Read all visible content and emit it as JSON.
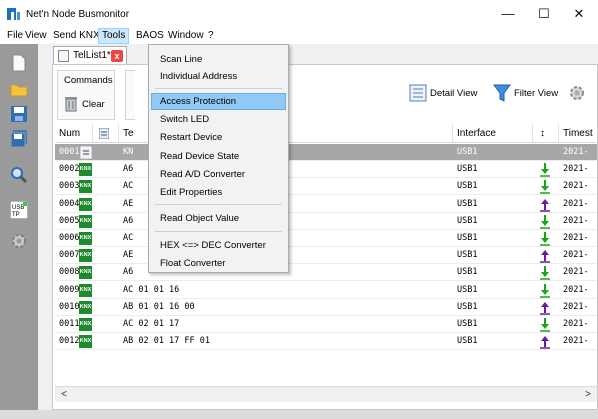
{
  "window": {
    "title": "Net'n Node Busmonitor",
    "minimize": "—",
    "maximize": "☐",
    "close": "✕"
  },
  "menubar": [
    "File",
    "View",
    "Send KNX",
    "Tools",
    "BAOS",
    "Window",
    "?"
  ],
  "tab": {
    "label": "TelList1*",
    "close": "x"
  },
  "commands": {
    "title": "Commands",
    "clear": "Clear"
  },
  "toolbar": {
    "detail_view": "Detail View",
    "filter_view": "Filter View"
  },
  "grid": {
    "headers": [
      "Num",
      "",
      "Te",
      "Interface",
      "↕",
      "Timest"
    ],
    "rows": [
      {
        "num": "0001",
        "icon": "bus-icon",
        "telegram": "KN",
        "interface": "USB1",
        "dir": "",
        "time": "2021-",
        "selected": true
      },
      {
        "num": "0002",
        "icon": "knx",
        "telegram": "A6",
        "interface": "USB1",
        "dir": "down",
        "time": "2021-"
      },
      {
        "num": "0003",
        "icon": "knx",
        "telegram": "AC",
        "interface": "USB1",
        "dir": "down",
        "time": "2021-"
      },
      {
        "num": "0004",
        "icon": "knx",
        "telegram": "AE",
        "interface": "USB1",
        "dir": "up",
        "time": "2021-"
      },
      {
        "num": "0005",
        "icon": "knx",
        "telegram": "A6",
        "interface": "USB1",
        "dir": "down",
        "time": "2021-"
      },
      {
        "num": "0006",
        "icon": "knx",
        "telegram": "AC",
        "interface": "USB1",
        "dir": "down",
        "time": "2021-"
      },
      {
        "num": "0007",
        "icon": "knx",
        "telegram": "AE",
        "interface": "USB1",
        "dir": "up",
        "time": "2021-"
      },
      {
        "num": "0008",
        "icon": "knx",
        "telegram": "A6",
        "interface": "USB1",
        "dir": "down",
        "time": "2021-"
      },
      {
        "num": "0009",
        "icon": "knx",
        "telegram": "AC 01 01 16",
        "interface": "USB1",
        "dir": "down",
        "time": "2021-"
      },
      {
        "num": "0010",
        "icon": "knx",
        "telegram": "AB 01 01 16 00",
        "interface": "USB1",
        "dir": "up",
        "time": "2021-"
      },
      {
        "num": "0011",
        "icon": "knx",
        "telegram": "AC 02 01 17",
        "interface": "USB1",
        "dir": "down",
        "time": "2021-"
      },
      {
        "num": "0012",
        "icon": "knx",
        "telegram": "AB 02 01 17 FF 01",
        "interface": "USB1",
        "dir": "up",
        "time": "2021-"
      }
    ],
    "knx_badge": "KNX"
  },
  "scroll": {
    "left": "<",
    "right": ">"
  },
  "tools_menu": {
    "items": [
      "Scan Line",
      "Individual Address",
      "Access Protection",
      "Switch LED",
      "Restart Device",
      "Read Device State",
      "Read A/D Converter",
      "Edit Properties",
      "Read Object Value",
      "HEX <=> DEC Converter",
      "Float Converter"
    ],
    "highlighted": "Access Protection"
  },
  "colors": {
    "arrow_down": "#1aa31a",
    "arrow_up": "#6a1b9a",
    "knx_green": "#1e8a2c",
    "selection_gray": "#a7a7a7",
    "menu_highlight": "#90c8f6"
  }
}
